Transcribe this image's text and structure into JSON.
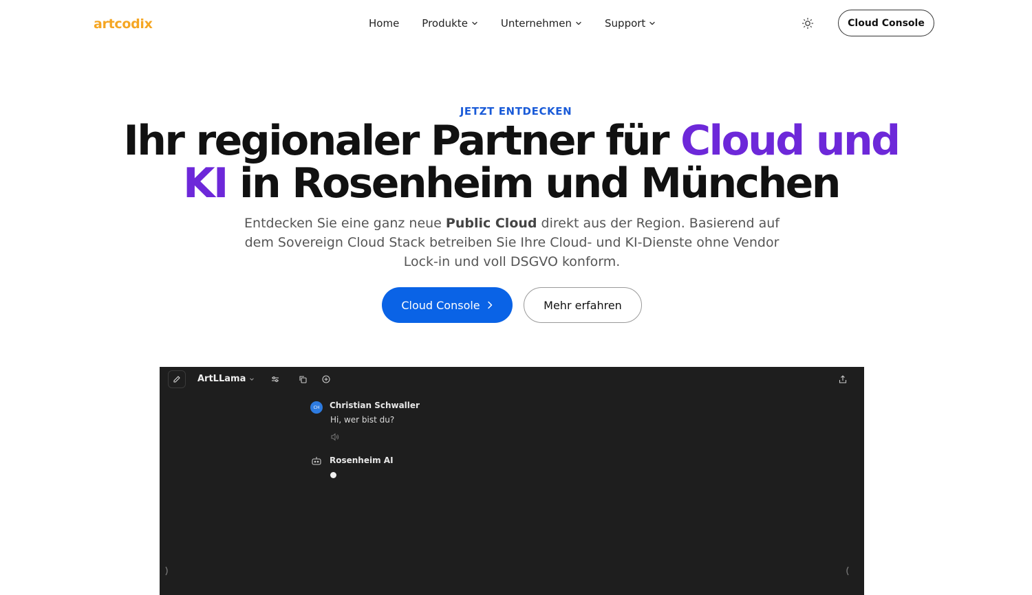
{
  "header": {
    "logo": "artcodix",
    "nav": [
      {
        "label": "Home",
        "has_dropdown": false
      },
      {
        "label": "Produkte",
        "has_dropdown": true
      },
      {
        "label": "Unternehmen",
        "has_dropdown": true
      },
      {
        "label": "Support",
        "has_dropdown": true
      }
    ],
    "console_button": "Cloud Console",
    "theme_icon": "sun-icon"
  },
  "hero": {
    "eyebrow": "JETZT ENTDECKEN",
    "headline_part1": "Ihr regionaler Partner für ",
    "headline_accent1": "Cloud und",
    "headline_accent2": "KI",
    "headline_part2": " in Rosenheim und München",
    "subtitle_pre": "Entdecken Sie eine ganz neue ",
    "subtitle_bold": "Public Cloud",
    "subtitle_post": " direkt aus der Region. Basierend auf dem Sovereign Cloud Stack betreiben Sie Ihre Cloud- und KI-Dienste ohne Vendor Lock-in und voll DSGVO konform.",
    "primary_button": "Cloud Console",
    "secondary_button": "Mehr erfahren"
  },
  "screenshot": {
    "model_name": "ArtLLama",
    "messages": [
      {
        "avatar": "CH",
        "author": "Christian Schwaller",
        "text": "Hi, wer bist du?"
      },
      {
        "author": "Rosenheim AI",
        "text": ""
      }
    ]
  },
  "colors": {
    "logo": "#f5a623",
    "eyebrow": "#1a5bd8",
    "accent": "#6d28d9",
    "primary_button": "#0a63e6",
    "screenshot_bg": "#1e1e1e"
  }
}
